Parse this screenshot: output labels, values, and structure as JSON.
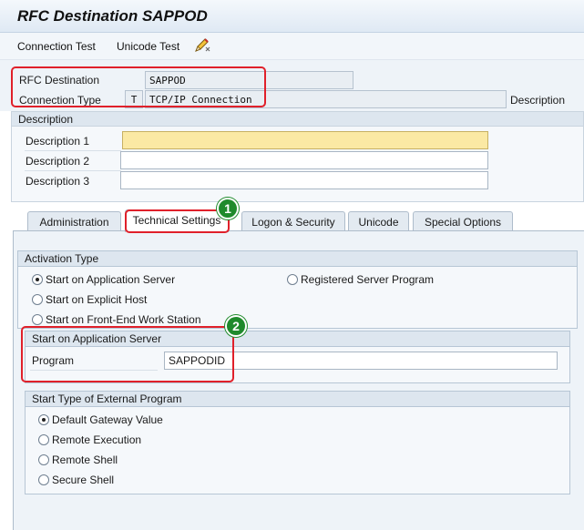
{
  "window": {
    "title": "RFC Destination SAPPOD"
  },
  "toolbar": {
    "connection_test": "Connection Test",
    "unicode_test": "Unicode Test",
    "edit_icon": "pencil-icon"
  },
  "header": {
    "rfc_destination_label": "RFC Destination",
    "rfc_destination_value": "SAPPOD",
    "connection_type_label": "Connection Type",
    "connection_type_code": "T",
    "connection_type_value": "TCP/IP Connection",
    "description_label": "Description"
  },
  "description_group": {
    "title": "Description",
    "rows": [
      {
        "label": "Description 1",
        "value": ""
      },
      {
        "label": "Description 2",
        "value": ""
      },
      {
        "label": "Description 3",
        "value": ""
      }
    ]
  },
  "tabs": [
    {
      "label": "Administration",
      "active": false
    },
    {
      "label": "Technical Settings",
      "active": true
    },
    {
      "label": "Logon & Security",
      "active": false
    },
    {
      "label": "Unicode",
      "active": false
    },
    {
      "label": "Special Options",
      "active": false
    }
  ],
  "activation_type": {
    "title": "Activation Type",
    "options": [
      {
        "label": "Start on Application Server",
        "selected": true
      },
      {
        "label": "Registered Server Program",
        "selected": false
      },
      {
        "label": "Start on Explicit Host",
        "selected": false
      },
      {
        "label": "Start on Front-End Work Station",
        "selected": false
      }
    ]
  },
  "app_server": {
    "title": "Start on Application Server",
    "program_label": "Program",
    "program_value": "SAPPODID"
  },
  "start_type": {
    "title": "Start Type of External Program",
    "options": [
      {
        "label": "Default Gateway Value",
        "selected": true
      },
      {
        "label": "Remote Execution",
        "selected": false
      },
      {
        "label": "Remote Shell",
        "selected": false
      },
      {
        "label": "Secure Shell",
        "selected": false
      }
    ]
  },
  "callouts": {
    "one": "1",
    "two": "2"
  },
  "colors": {
    "highlight": "#e0202a",
    "badge": "#1f8a2c",
    "active_input": "#fbe9a4"
  }
}
